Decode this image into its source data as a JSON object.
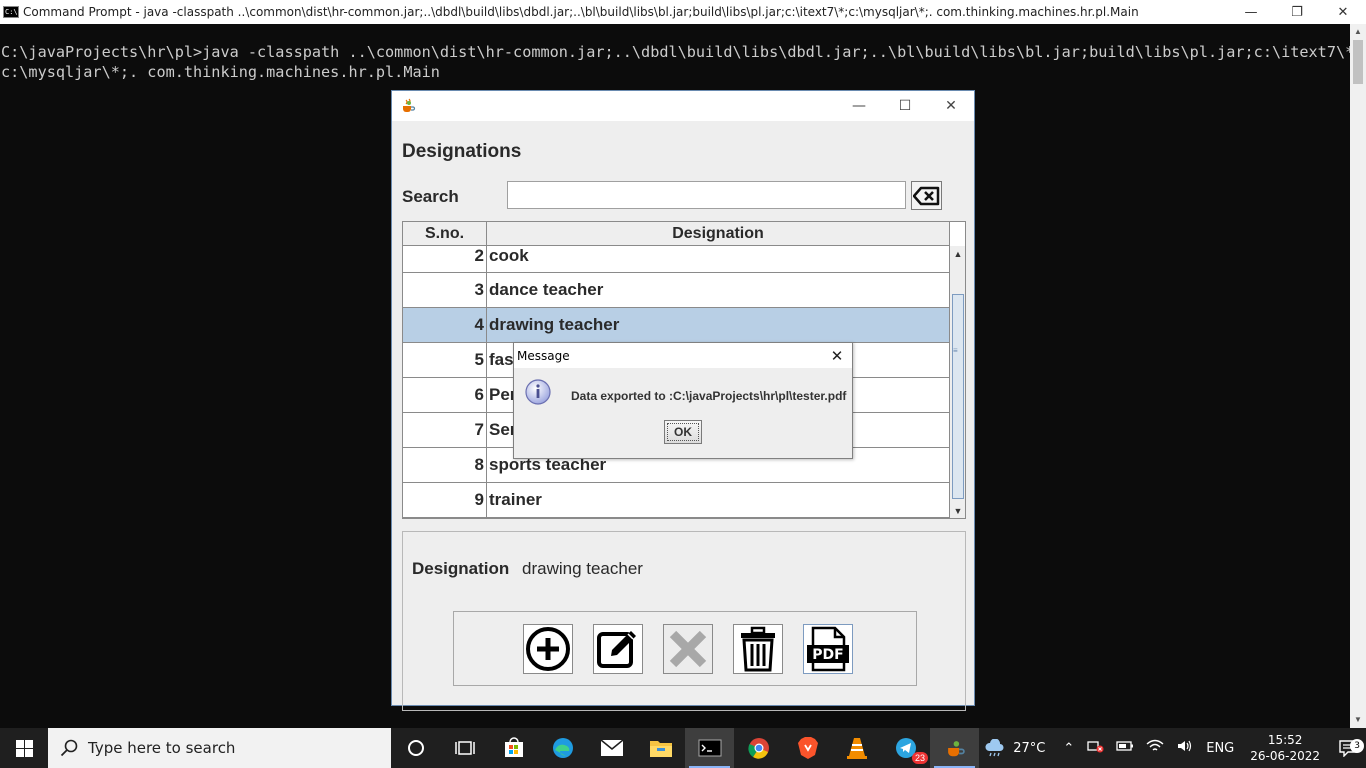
{
  "console_window": {
    "title": "Command Prompt - java  -classpath ..\\common\\dist\\hr-common.jar;..\\dbdl\\build\\libs\\dbdl.jar;..\\bl\\build\\libs\\bl.jar;build\\libs\\pl.jar;c:\\itext7\\*;c:\\mysqljar\\*;. com.thinking.machines.hr.pl.Main",
    "icon_text": "C:\\",
    "minimize": "—",
    "maximize": "❐",
    "close": "✕",
    "lines": [
      "C:\\javaProjects\\hr\\pl>java -classpath ..\\common\\dist\\hr-common.jar;..\\dbdl\\build\\libs\\dbdl.jar;..\\bl\\build\\libs\\bl.jar;build\\libs\\pl.jar;c:\\itext7\\*;",
      "c:\\mysqljar\\*;. com.thinking.machines.hr.pl.Main"
    ]
  },
  "app_window": {
    "minimize": "—",
    "maximize": "☐",
    "close": "✕",
    "heading": "Designations",
    "search_label": "Search",
    "search_value": "",
    "table": {
      "columns": [
        "S.no.",
        "Designation"
      ],
      "rows": [
        {
          "sno": "2",
          "designation": "cook"
        },
        {
          "sno": "3",
          "designation": "dance teacher"
        },
        {
          "sno": "4",
          "designation": "drawing teacher"
        },
        {
          "sno": "5",
          "designation": "fas"
        },
        {
          "sno": "6",
          "designation": "Per"
        },
        {
          "sno": "7",
          "designation": "Ser"
        },
        {
          "sno": "8",
          "designation": "sports teacher"
        },
        {
          "sno": "9",
          "designation": "trainer"
        }
      ],
      "selected_row_index": 2
    },
    "detail": {
      "label": "Designation",
      "value": "drawing teacher"
    },
    "toolbar_icons": [
      "add-icon",
      "edit-icon",
      "cancel-icon",
      "delete-icon",
      "pdf-icon"
    ]
  },
  "dialog": {
    "title": "Message",
    "close": "✕",
    "message": "Data exported to :C:\\javaProjects\\hr\\pl\\tester.pdf",
    "ok_label": "OK"
  },
  "taskbar": {
    "search_placeholder": "Type here to search",
    "weather": "27°C",
    "language": "ENG",
    "time": "15:52",
    "date": "26-06-2022",
    "notification_count": "3",
    "telegram_badge": "23",
    "colors": {
      "background": "#1f1f1f",
      "accent": "#8ab4f8"
    }
  },
  "colors": {
    "selection": "#b8cfe5",
    "panel": "#eeeeee",
    "console_bg": "#0c0c0c",
    "console_text": "#cccccc"
  }
}
